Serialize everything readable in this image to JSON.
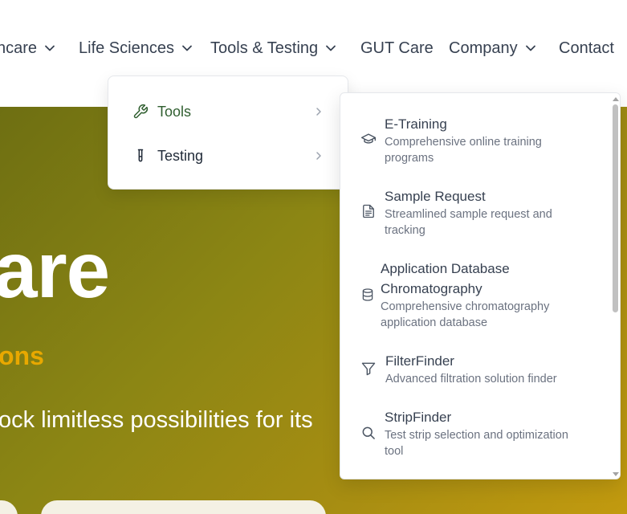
{
  "nav": {
    "items": [
      {
        "label": "hcare",
        "has_dropdown": true
      },
      {
        "label": "Life Sciences",
        "has_dropdown": true
      },
      {
        "label": "Tools & Testing",
        "has_dropdown": true
      },
      {
        "label": "GUT Care",
        "has_dropdown": false
      },
      {
        "label": "Company",
        "has_dropdown": true
      },
      {
        "label": "Contact",
        "has_dropdown": false
      }
    ]
  },
  "hero": {
    "title": "are",
    "subtitle": "ons",
    "text": "ock limitless possibilities for its"
  },
  "dropdown": {
    "items": [
      {
        "label": "Tools",
        "icon": "wrench-icon",
        "color": "#2f5e2f"
      },
      {
        "label": "Testing",
        "icon": "test-tube-icon",
        "color": "#1f2937"
      }
    ]
  },
  "submenu": {
    "items": [
      {
        "title": "E-Training",
        "desc1": "Comprehensive online training",
        "desc2": "programs",
        "icon": "graduation-cap-icon"
      },
      {
        "title": "Sample Request",
        "desc1": "Streamlined sample request and",
        "desc2": "tracking",
        "icon": "document-icon"
      },
      {
        "title1": "Application Database",
        "title2": "Chromatography",
        "desc1": "Comprehensive chromatography",
        "desc2": "application database",
        "icon": "database-icon"
      },
      {
        "title": "FilterFinder",
        "desc1": "Advanced filtration solution finder",
        "icon": "filter-icon"
      },
      {
        "title": "StripFinder",
        "desc1": "Test strip selection and optimization",
        "desc2": "tool",
        "icon": "search-icon"
      }
    ]
  },
  "colors": {
    "accent_green": "#2f5e2f",
    "hero_gradient_start": "#6e6f12",
    "hero_gradient_end": "#c29a0f",
    "hero_subtitle": "#e8a800"
  }
}
